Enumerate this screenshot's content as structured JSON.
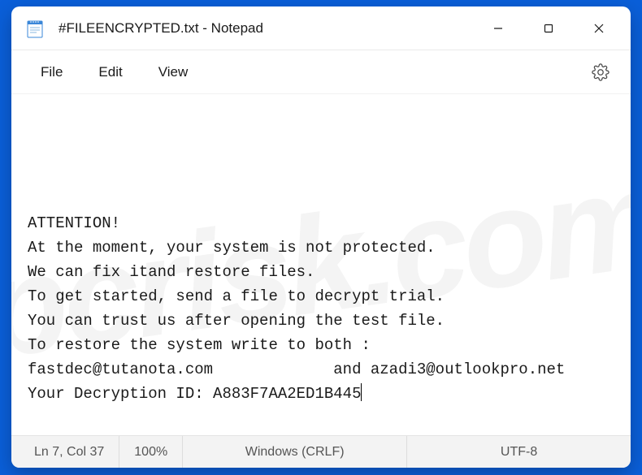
{
  "window": {
    "title": "#FILEENCRYPTED.txt - Notepad"
  },
  "menubar": {
    "file": "File",
    "edit": "Edit",
    "view": "View"
  },
  "content": {
    "line1": "ATTENTION!",
    "line2": "At the moment, your system is not protected.",
    "line3": "We can fix itand restore files.",
    "line4": "To get started, send a file to decrypt trial.",
    "line5": "You can trust us after opening the test file.",
    "line6": "To restore the system write to both :",
    "line7": "fastdec@tutanota.com             and azadi3@outlookpro.net",
    "line8": "Your Decryption ID: A883F7AA2ED1B445"
  },
  "statusbar": {
    "position": "Ln 7, Col 37",
    "zoom": "100%",
    "lineending": "Windows (CRLF)",
    "encoding": "UTF-8"
  },
  "watermark": "pcrisk.com"
}
